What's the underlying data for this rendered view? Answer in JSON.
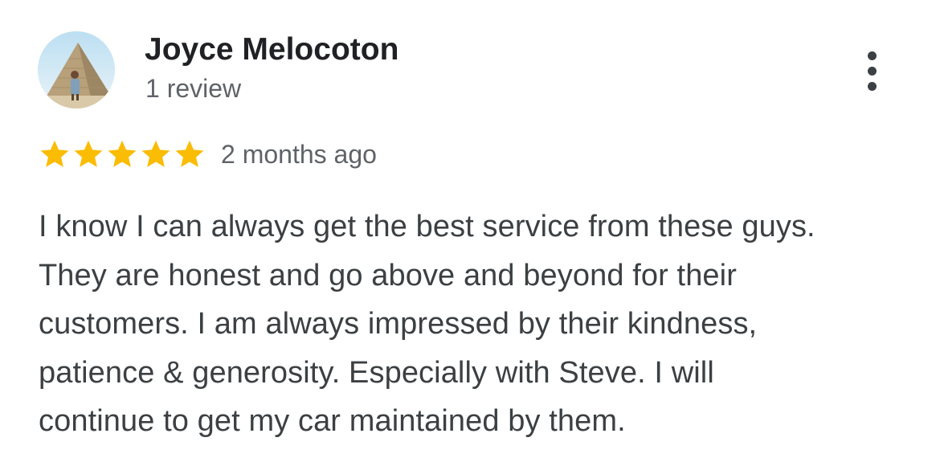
{
  "reviewer": {
    "name": "Joyce Melocoton",
    "review_count": "1 review",
    "avatar_icon": "profile-photo-pyramid"
  },
  "rating": {
    "stars": 5,
    "max_stars": 5,
    "star_color": "#fbbc04",
    "date": "2 months ago"
  },
  "review": {
    "lines": [
      "I know I can always get the best service from these guys.",
      "They are honest and go above and beyond for their",
      "customers. I am always impressed by their kindness,",
      "patience & generosity. Especially with Steve. I will",
      "continue to get my car maintained by them."
    ]
  },
  "menu": {
    "icon": "more-vert-icon"
  }
}
